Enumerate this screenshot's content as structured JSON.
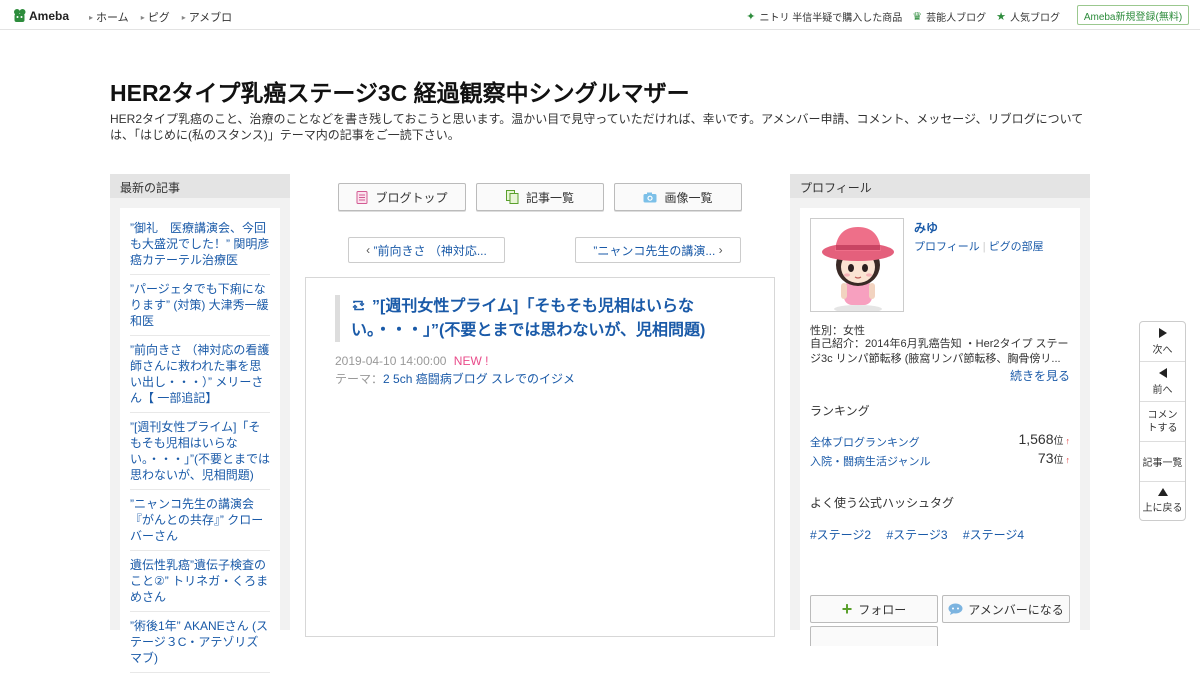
{
  "topbar": {
    "logo_text": "Ameba",
    "nav": [
      "ホーム",
      "ピグ",
      "アメブロ"
    ],
    "right_links": [
      {
        "label": "ニトリ 半信半疑で購入した商品",
        "icon": "sparkle-icon"
      },
      {
        "label": "芸能人ブログ",
        "icon": "crown-icon"
      },
      {
        "label": "人気ブログ",
        "icon": "star-icon"
      }
    ],
    "signup_label": "Ameba新規登録(無料)"
  },
  "header": {
    "title": "HER2タイプ乳癌ステージ3C 経過観察中シングルマザー",
    "description": "HER2タイプ乳癌のこと、治療のことなどを書き残しておこうと思います。温かい目で見守っていただければ、幸いです。アメンバー申請、コメント、メッセージ、リブログについては、「はじめに(私のスタンス)」テーマ内の記事をご一読下さい。"
  },
  "left_sidebar": {
    "heading": "最新の記事",
    "items": [
      "”御礼　医療講演会、今回も大盛況でした！” 関明彦 癌カテーテル治療医",
      "”パージェタでも下痢になります” (対策) 大津秀一緩和医",
      "”前向きさ （神対応の看護師さんに救われた事を思い出し・・・）” メリーさん【 一部追記】",
      "”[週刊女性プライム]「そもそも児相はいらない。・・・」”(不要とまでは思わないが、児相問題)",
      "”ニャンコ先生の講演会『がんとの共存』” クローバーさん",
      "遺伝性乳癌”遺伝子検査のこと②” トリネガ・くろまめさん",
      "”術後1年” AKANEさん (ステージ３C・アテゾリズマブ)"
    ]
  },
  "center": {
    "buttons": [
      {
        "label": "ブログトップ",
        "icon": "document-icon"
      },
      {
        "label": "記事一覧",
        "icon": "copy-icon"
      },
      {
        "label": "画像一覧",
        "icon": "camera-icon"
      }
    ],
    "prev_label": "”前向きさ （神対応...",
    "next_label": "”ニャンコ先生の講演...",
    "article": {
      "title": "”[週刊女性プライム]「そもそも児相はいらない。・・・」”(不要とまでは思わないが、児相問題)",
      "date": "2019-04-10 14:00:00",
      "new_badge": "NEW !",
      "theme_prefix": "テーマ：",
      "theme": "2 5ch 癌闘病ブログ スレでのイジメ"
    }
  },
  "profile": {
    "heading": "プロフィール",
    "name": "みゆ",
    "link_profile": "プロフィール",
    "link_pig": "ピグの部屋",
    "gender": "性別：女性",
    "intro": "自己紹介：2014年6月乳癌告知 ・Her2タイプ ステージ3c リンパ節転移 (腋窩リンパ節転移、胸骨傍リ...",
    "more": "続きを見る",
    "ranking_heading": "ランキング",
    "rankings": [
      {
        "label": "全体ブログランキング",
        "value": "1,568",
        "unit": "位",
        "trend": "↑"
      },
      {
        "label": "入院・闘病生活ジャンル",
        "value": "73",
        "unit": "位",
        "trend": "↑"
      }
    ],
    "hashtag_heading": "よく使う公式ハッシュタグ",
    "hashtags": [
      "#ステージ2",
      "#ステージ3",
      "#ステージ4"
    ],
    "follow_label": "フォロー",
    "amember_label": "アメンバーになる"
  },
  "sidenav": {
    "next": "次へ",
    "prev": "前へ",
    "comment": "コメントする",
    "list": "記事一覧",
    "top": "上に戻る"
  },
  "colors": {
    "link": "#1a5aa8",
    "brand_green": "#2d8c3c",
    "new_badge": "#e94b8a"
  }
}
